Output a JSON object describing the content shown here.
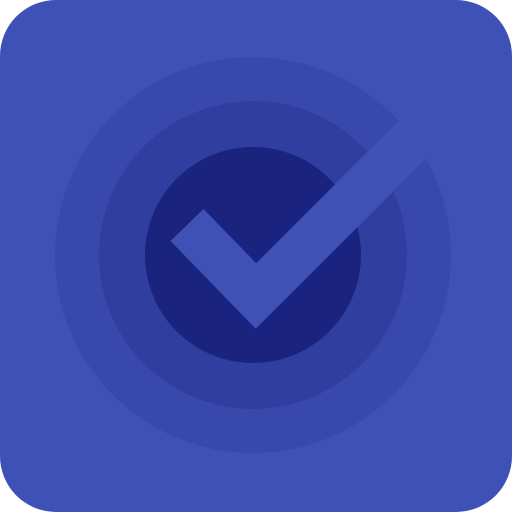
{
  "icon": {
    "name": "checkmark-app-icon",
    "glyph": "check-icon",
    "colors": {
      "tile": "#3F51B5",
      "ring_outer": "#3949AB",
      "ring_middle": "#303F9F",
      "core": "#1A237E",
      "check": "#3F51B5"
    }
  }
}
